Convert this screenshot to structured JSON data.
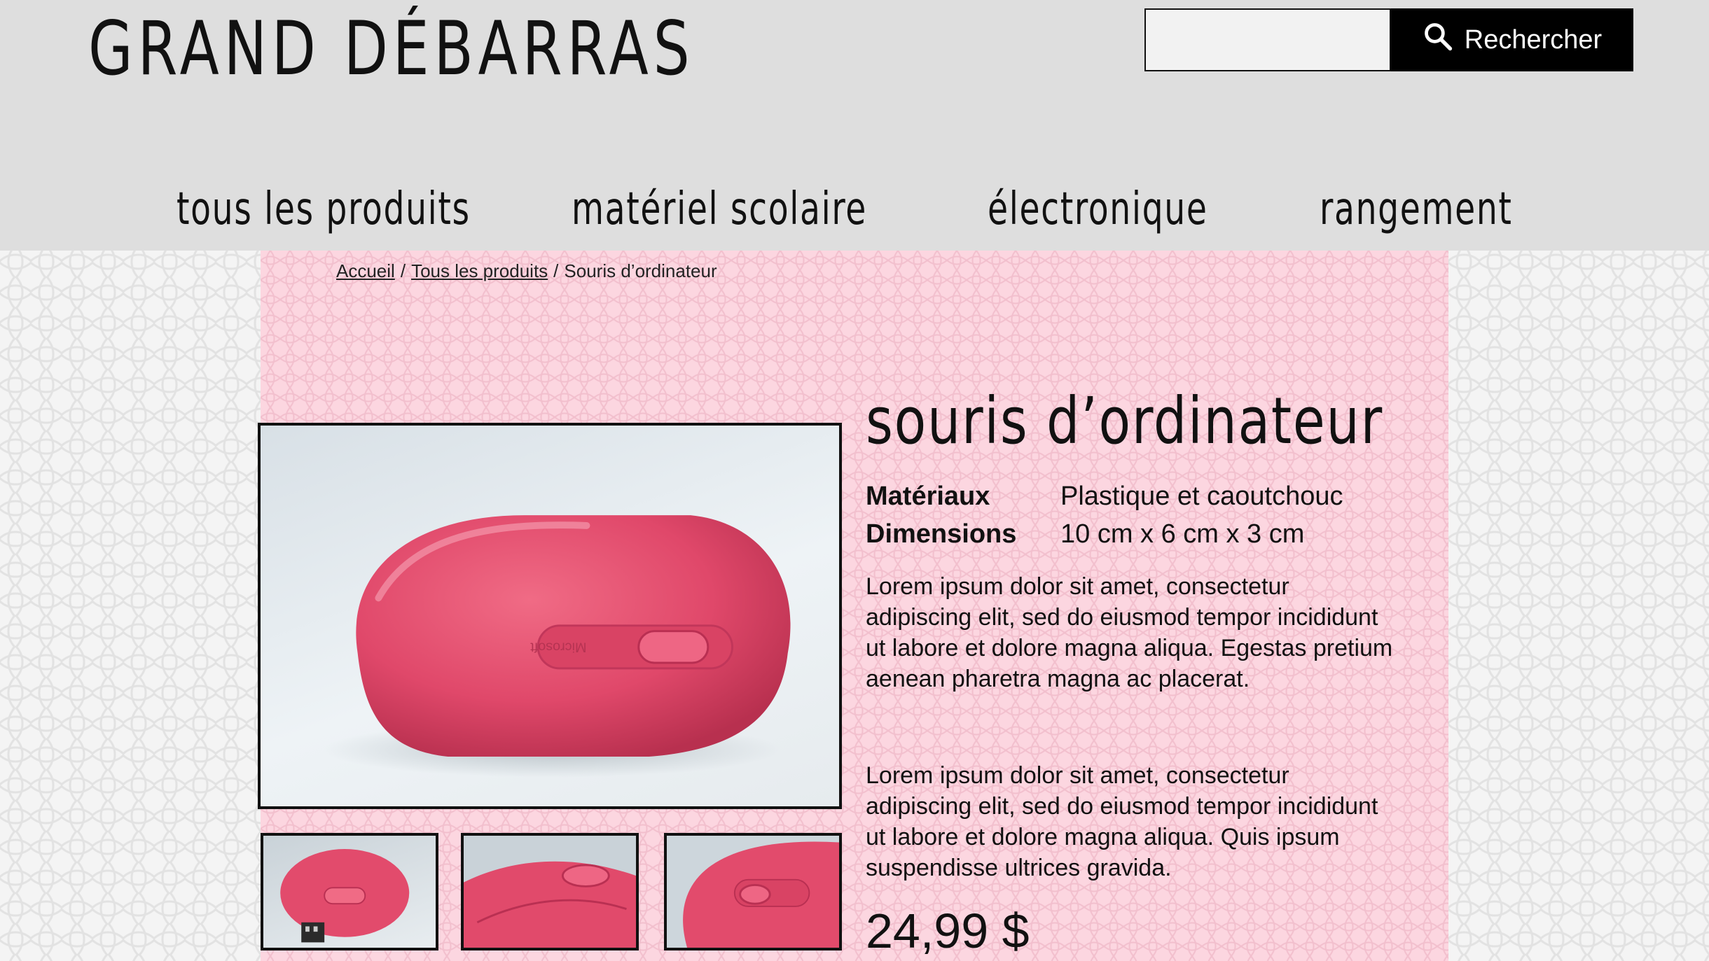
{
  "header": {
    "site_title": "GRAND DÉBARRAS",
    "search": {
      "placeholder": "",
      "button_label": "Rechercher",
      "icon": "search-icon"
    }
  },
  "nav": {
    "items": [
      {
        "label": "tous les produits"
      },
      {
        "label": "matériel scolaire"
      },
      {
        "label": "électronique"
      },
      {
        "label": "rangement"
      }
    ]
  },
  "breadcrumb": {
    "home": "Accueil",
    "separator": "/",
    "category": "Tous les produits",
    "current": "Souris d’ordinateur"
  },
  "product": {
    "title": "souris d’ordinateur",
    "specs": [
      {
        "label": "Matériaux",
        "value": "Plastique et caoutchouc"
      },
      {
        "label": "Dimensions",
        "value": "10 cm x 6 cm x 3 cm"
      }
    ],
    "description": [
      "Lorem ipsum dolor sit amet, consectetur adipiscing elit, sed do eiusmod tempor incididunt ut labore et dolore magna aliqua. Egestas pretium aenean pharetra magna ac placerat.",
      "Lorem ipsum dolor sit amet, consectetur adipiscing elit, sed do eiusmod tempor incididunt ut labore et dolore magna aliqua. Quis ipsum suspendisse ultrices gravida."
    ],
    "price": "24,99 $",
    "image_logo_text": "Microsoft"
  },
  "colors": {
    "header_bg": "#dedede",
    "panel_bg": "#fcd6e0",
    "mouse_pink": "#e9536e",
    "button_bg": "#000000"
  }
}
